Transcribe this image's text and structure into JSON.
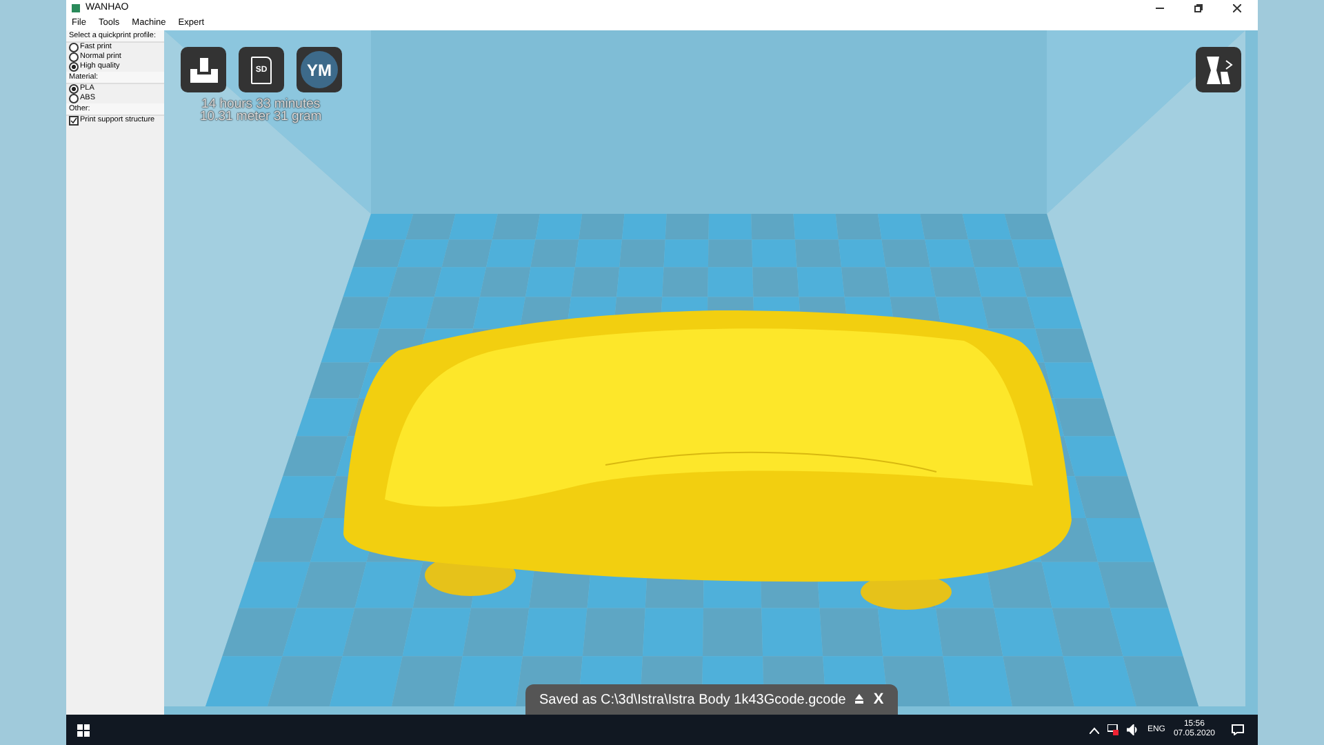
{
  "window": {
    "title": "WANHAO"
  },
  "menu": [
    "File",
    "Tools",
    "Machine",
    "Expert"
  ],
  "sidebar": {
    "sections": [
      {
        "title": "Select a quickprint profile:",
        "kind": "radio",
        "options": [
          {
            "label": "Fast print",
            "selected": false
          },
          {
            "label": "Normal print",
            "selected": false
          },
          {
            "label": "High quality",
            "selected": true
          }
        ]
      },
      {
        "title": "Material:",
        "kind": "radio",
        "options": [
          {
            "label": "PLA",
            "selected": true
          },
          {
            "label": "ABS",
            "selected": false
          }
        ]
      },
      {
        "title": "Other:",
        "kind": "checkbox",
        "options": [
          {
            "label": "Print support structure",
            "checked": true
          }
        ]
      }
    ]
  },
  "viewport": {
    "toolbar": [
      "SD",
      "YM"
    ],
    "print_info": [
      "14 hours 33 minutes",
      "10.31 meter 31 gram"
    ],
    "toast": {
      "text": "Saved as C:\\3d\\Istra\\Istra Body 1k43Gcode.gcode",
      "close": "X"
    }
  },
  "taskbar": {
    "language": "ENG",
    "time": "15:56",
    "date": "07.05.2020"
  }
}
